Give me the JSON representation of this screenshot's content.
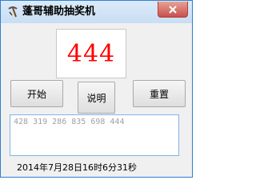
{
  "window": {
    "title": "蓬哥辅助抽奖机",
    "close_icon": "close-x-icon",
    "app_icon": "pickaxe-icon"
  },
  "display": {
    "number": "444",
    "number_color": "#ff0000"
  },
  "buttons": {
    "start": "开始",
    "info": "说明",
    "reset": "重置"
  },
  "history": "428 319 286 835 698 444",
  "timestamp": "2014年7月28日16时6分31秒"
}
